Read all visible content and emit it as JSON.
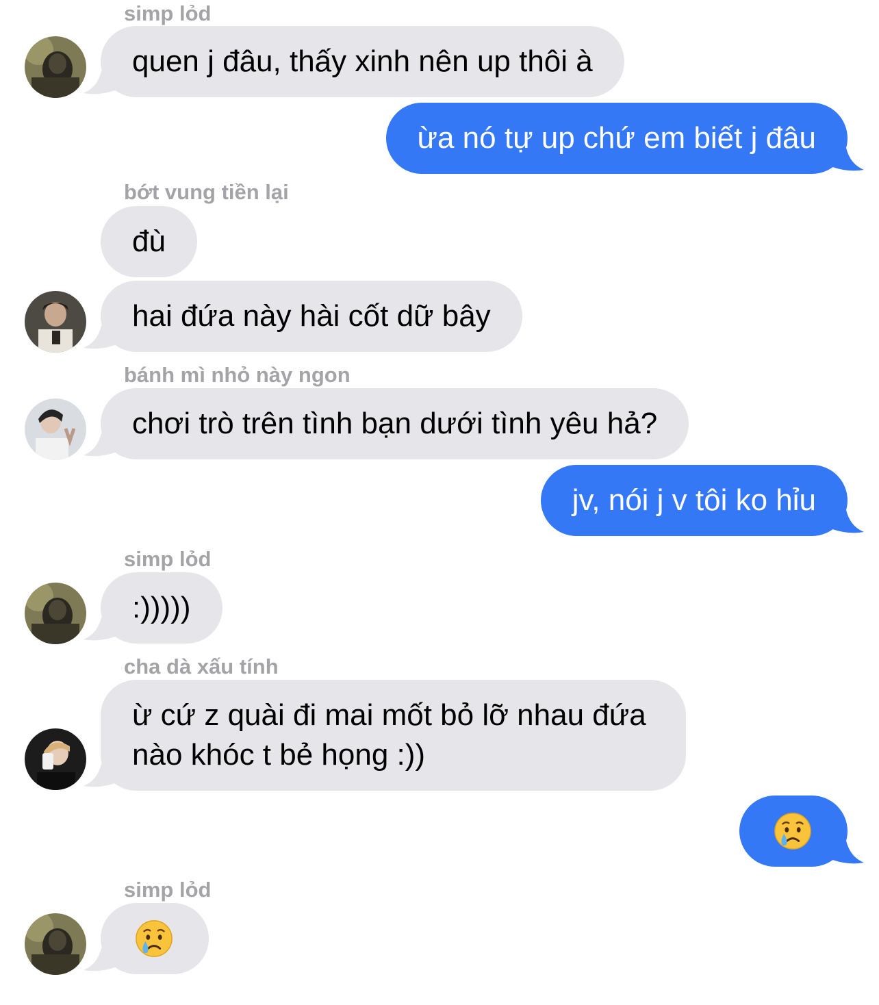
{
  "colors": {
    "incoming_bubble": "#e5e5ea",
    "outgoing_bubble": "#3478f6",
    "sender_name": "#a3a3a8"
  },
  "messages": [
    {
      "sender": "simp lỏd",
      "text": "quen j đâu, thấy xinh nên up thôi à",
      "direction": "incoming",
      "avatar": "avatar-simp-lod"
    },
    {
      "text": "ừa nó tự up chứ em biết j đâu",
      "direction": "outgoing"
    },
    {
      "sender": "bớt vung tiền lại",
      "text": "đù",
      "direction": "incoming"
    },
    {
      "text": "hai đứa này hài cốt dữ bây",
      "direction": "incoming",
      "avatar": "avatar-bot-vung-tien-lai"
    },
    {
      "sender": "bánh mì nhỏ này ngon",
      "text": "chơi trò trên tình bạn dưới tình yêu hả?",
      "direction": "incoming",
      "avatar": "avatar-banh-mi-nho-nay-ngon"
    },
    {
      "text": "jv, nói j v tôi ko hỉu",
      "direction": "outgoing"
    },
    {
      "sender": "simp lỏd",
      "text": ":)))))",
      "direction": "incoming",
      "avatar": "avatar-simp-lod"
    },
    {
      "sender": "cha dà xấu tính",
      "text_line1": "ừ cứ z quài đi mai mốt bỏ lỡ nhau đứa",
      "text_line2": "nào khóc t bẻ họng :))",
      "direction": "incoming",
      "avatar": "avatar-cha-da-xau-tinh"
    },
    {
      "emoji": "crying-face-emoji",
      "direction": "outgoing"
    },
    {
      "sender": "simp lỏd",
      "emoji": "crying-face-emoji",
      "direction": "incoming",
      "avatar": "avatar-simp-lod"
    }
  ]
}
